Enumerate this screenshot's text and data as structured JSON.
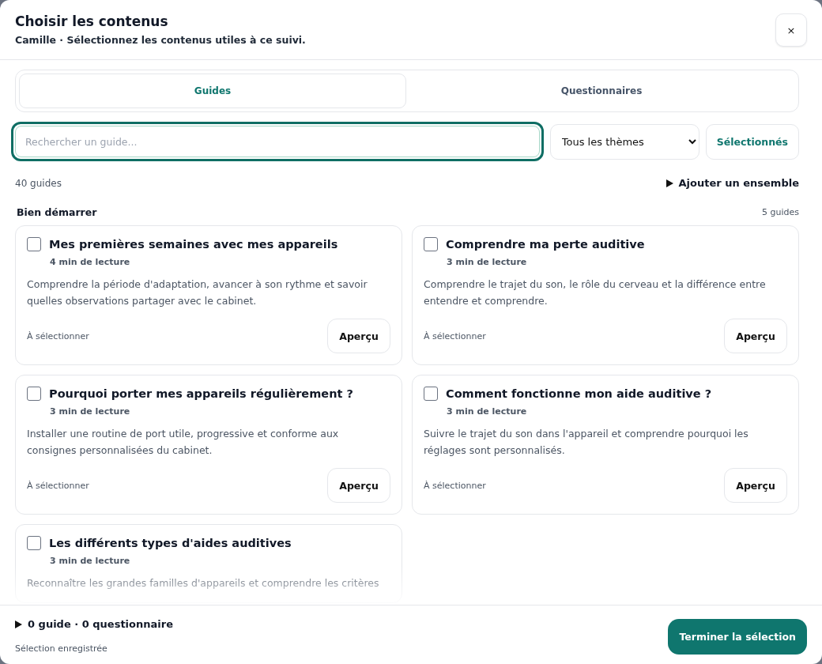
{
  "dialog": {
    "title": "Choisir les contenus",
    "subtitle": "Camille · Sélectionnez les contenus utiles à ce suivi.",
    "close": "×"
  },
  "tabs": [
    {
      "label": "Guides",
      "selected": true
    },
    {
      "label": "Questionnaires",
      "selected": false
    }
  ],
  "search": {
    "placeholder": "Rechercher un guide...",
    "focused": true
  },
  "theme_select": {
    "value": "Tous les thèmes"
  },
  "selected_filter": {
    "label": "Sélectionnés"
  },
  "count": "40 guides",
  "add_set": {
    "label": "Ajouter un ensemble",
    "expanded": false
  },
  "section": {
    "title": "Bien démarrer",
    "count": "5 guides"
  },
  "guides": [
    {
      "title": "Mes premières semaines avec mes appareils",
      "duration": "4 min de lecture",
      "description": "Comprendre la période d'adaptation, avancer à son rythme et savoir quelles observations partager avec le cabinet.",
      "status": "À sélectionner",
      "preview": "Aperçu",
      "checked": false
    },
    {
      "title": "Comprendre ma perte auditive",
      "duration": "3 min de lecture",
      "description": "Comprendre le trajet du son, le rôle du cerveau et la différence entre entendre et comprendre.",
      "status": "À sélectionner",
      "preview": "Aperçu",
      "checked": false
    },
    {
      "title": "Pourquoi porter mes appareils régulièrement ?",
      "duration": "3 min de lecture",
      "description": "Installer une routine de port utile, progressive et conforme aux consignes personnalisées du cabinet.",
      "status": "À sélectionner",
      "preview": "Aperçu",
      "checked": false
    },
    {
      "title": "Comment fonctionne mon aide auditive ?",
      "duration": "3 min de lecture",
      "description": "Suivre le trajet du son dans l'appareil et comprendre pourquoi les réglages sont personnalisés.",
      "status": "À sélectionner",
      "preview": "Aperçu",
      "checked": false
    },
    {
      "title": "Les différents types d'aides auditives",
      "duration": "3 min de lecture",
      "description": "Reconnaître les grandes familles d'appareils et comprendre les critères",
      "checked": false
    }
  ],
  "footer": {
    "summary": "0 guide · 0 questionnaire",
    "summary_expanded": false,
    "saved": "Sélection enregistrée",
    "finish": "Terminer la sélection"
  }
}
